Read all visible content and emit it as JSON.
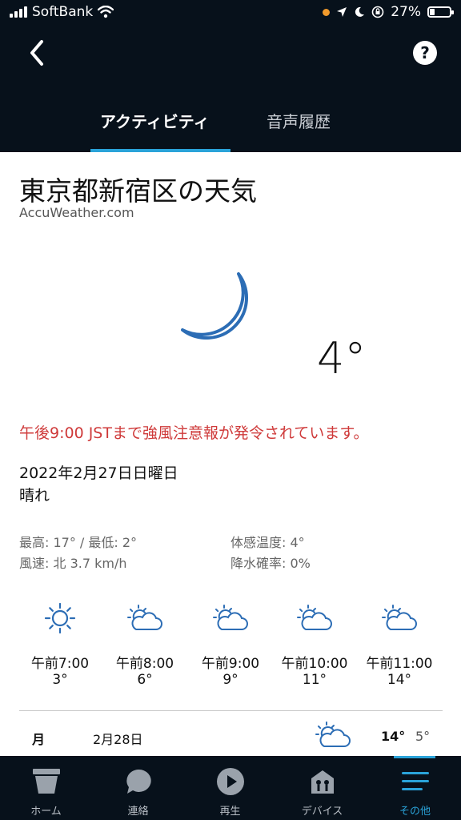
{
  "status_bar": {
    "carrier": "SoftBank",
    "battery": "27%"
  },
  "header": {
    "help_label": "?",
    "tabs": [
      {
        "label": "アクティビティ",
        "active": true
      },
      {
        "label": "音声履歴",
        "active": false
      }
    ]
  },
  "weather": {
    "title": "東京都新宿区の天気",
    "source": "AccuWeather.com",
    "current_icon": "moon-icon",
    "temperature": "4°",
    "alert": "午後9:00 JSTまで強風注意報が発令されています。",
    "date": "2022年2月27日日曜日",
    "condition": "晴れ",
    "high_low": "最高: 17° / 最低: 2°",
    "feels_like": "体感温度: 4°",
    "wind": "風速: 北  3.7 km/h",
    "precip": "降水確率: 0%",
    "hourly": [
      {
        "time": "午前7:00",
        "temp": "3°",
        "icon": "sun-icon"
      },
      {
        "time": "午前8:00",
        "temp": "6°",
        "icon": "partly-cloudy-icon"
      },
      {
        "time": "午前9:00",
        "temp": "9°",
        "icon": "partly-cloudy-icon"
      },
      {
        "time": "午前10:00",
        "temp": "11°",
        "icon": "partly-cloudy-icon"
      },
      {
        "time": "午前11:00",
        "temp": "14°",
        "icon": "partly-cloudy-icon"
      }
    ],
    "daily": [
      {
        "day": "月",
        "date": "2月28日",
        "icon": "partly-cloudy-icon",
        "high": "14°",
        "low": "5°"
      }
    ]
  },
  "nav": {
    "items": [
      {
        "label": "ホーム",
        "icon": "home-icon"
      },
      {
        "label": "連絡",
        "icon": "chat-icon"
      },
      {
        "label": "再生",
        "icon": "play-icon"
      },
      {
        "label": "デバイス",
        "icon": "devices-icon"
      },
      {
        "label": "その他",
        "icon": "menu-icon",
        "active": true
      }
    ]
  },
  "colors": {
    "header_bg": "#07111b",
    "accent": "#2aa3d9",
    "alert": "#cf3a3a",
    "icon_blue": "#2c6db5"
  }
}
